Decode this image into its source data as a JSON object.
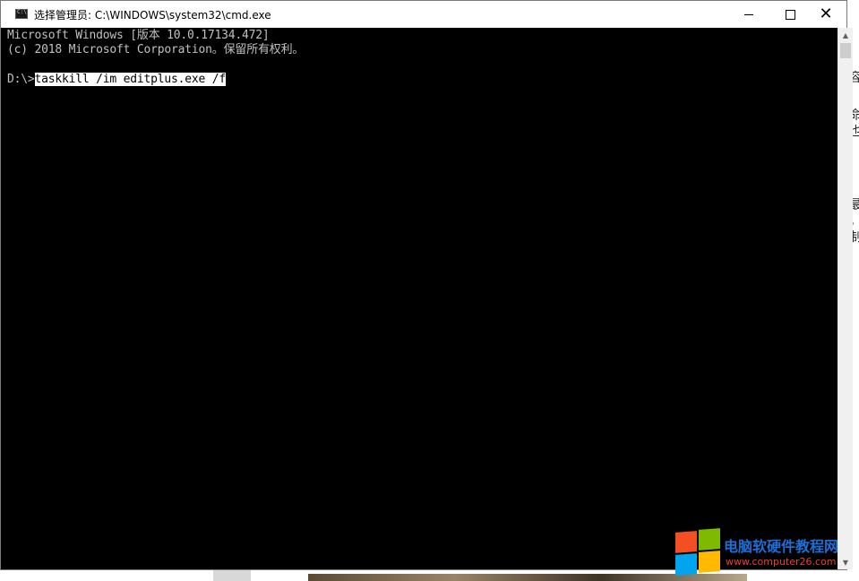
{
  "window": {
    "title": "选择管理员: C:\\WINDOWS\\system32\\cmd.exe",
    "app_icon": "cmd-icon",
    "controls": {
      "minimize": "minimize-icon",
      "maximize": "maximize-icon",
      "close_glyph": "✕"
    }
  },
  "console": {
    "line1": "Microsoft Windows [版本 10.0.17134.472]",
    "line2": "(c) 2018 Microsoft Corporation。保留所有权利。",
    "prompt": "D:\\>",
    "command": "taskkill /im editplus.exe /f",
    "bg_color": "#000000",
    "text_color": "#c0c0c0"
  },
  "scrollbar": {
    "up_glyph": "▲",
    "down_glyph": "▼"
  },
  "watermark": {
    "title": "电脑软硬件教程网",
    "url": "www.computer26.com"
  },
  "background_right_chars": [
    "容",
    "命",
    "也",
    "最",
    "，",
    "制"
  ]
}
